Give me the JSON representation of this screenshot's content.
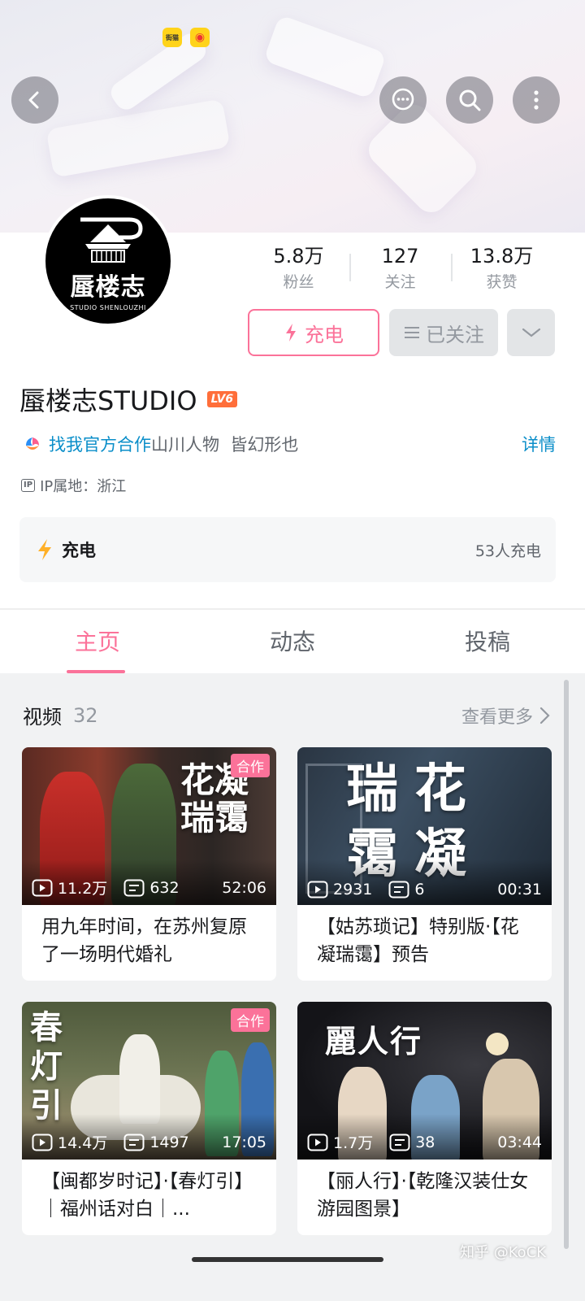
{
  "header": {
    "badges": [
      "街猫",
      "微博"
    ]
  },
  "profile": {
    "avatar_name": "蜃楼志",
    "avatar_subtitle": "STUDIO SHENLOUZHI",
    "name": "蜃楼志STUDIO",
    "level": "LV6",
    "stats": [
      {
        "value": "5.8万",
        "label": "粉丝"
      },
      {
        "value": "127",
        "label": "关注"
      },
      {
        "value": "13.8万",
        "label": "获赞"
      }
    ],
    "charge_button": "充电",
    "followed_button": "已关注",
    "bio_link": "找我官方合作",
    "bio_text": "山川人物  皆幻形也",
    "bio_detail": "详情",
    "ip": "IP属地：浙江",
    "ip_icon": "IP",
    "charge_card": {
      "title": "充电",
      "count": "53人充电"
    }
  },
  "tabs": [
    "主页",
    "动态",
    "投稿"
  ],
  "videos_section": {
    "title": "视频",
    "count": "32",
    "more": "查看更多"
  },
  "videos": [
    {
      "title": "用九年时间，在苏州复原了一场明代婚礼",
      "plays": "11.2万",
      "danmaku": "632",
      "duration": "52:06",
      "tag": "合作",
      "calligraphy": "花凝瑞霭"
    },
    {
      "title": "【姑苏琐记】特别版·【花凝瑞霭】预告",
      "plays": "2931",
      "danmaku": "6",
      "duration": "00:31",
      "tag": "",
      "calligraphy": "瑞花霭凝"
    },
    {
      "title": "【闽都岁时记】·【春灯引】｜福州话对白｜...",
      "plays": "14.4万",
      "danmaku": "1497",
      "duration": "17:05",
      "tag": "合作",
      "calligraphy": "春灯引"
    },
    {
      "title": "【丽人行】·【乾隆汉装仕女游园图景】",
      "plays": "1.7万",
      "danmaku": "38",
      "duration": "03:44",
      "tag": "",
      "calligraphy": "麗人行"
    }
  ],
  "watermark": "知乎 @KoCK",
  "colors": {
    "accent": "#fb7299",
    "link": "#0a8ec9",
    "level_badge": "#ff6e3a"
  }
}
